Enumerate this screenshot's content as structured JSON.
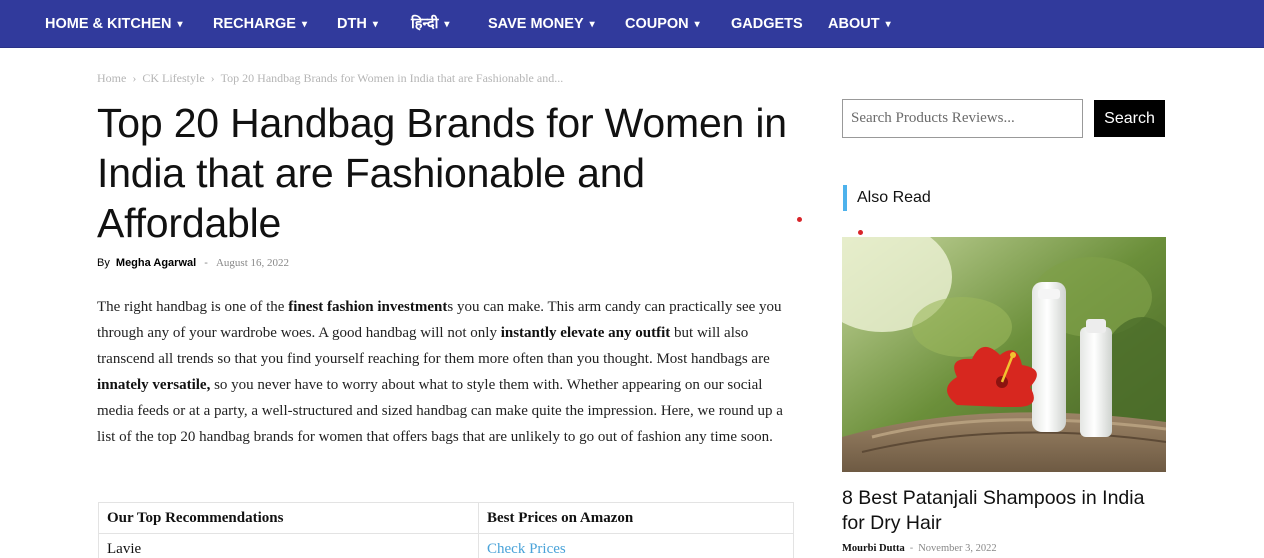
{
  "nav": {
    "items": [
      {
        "label": "HOME & KITCHEN",
        "has_dropdown": true
      },
      {
        "label": "RECHARGE",
        "has_dropdown": true
      },
      {
        "label": "DTH",
        "has_dropdown": true
      },
      {
        "label": "हिन्दी",
        "has_dropdown": true
      },
      {
        "label": "SAVE MONEY",
        "has_dropdown": true
      },
      {
        "label": "COUPON",
        "has_dropdown": true
      },
      {
        "label": "GADGETS",
        "has_dropdown": false
      },
      {
        "label": "ABOUT",
        "has_dropdown": true
      }
    ],
    "chevron": "▾",
    "background_color": "#313a9c"
  },
  "breadcrumb": {
    "home": "Home",
    "category": "CK Lifestyle",
    "current": "Top 20 Handbag Brands for Women in India that are Fashionable and...",
    "separator": "›"
  },
  "article": {
    "title": "Top 20 Handbag Brands for Women in India that are Fashionable and Affordable",
    "by_label": "By",
    "author": "Megha Agarwal",
    "meta_separator": "-",
    "date": "August 16, 2022",
    "intro": {
      "p1": "The right handbag is one of the ",
      "b1": "finest fashion investment",
      "p2": "s you can make. This arm candy can practically see you through any of your wardrobe woes. A good handbag will not only ",
      "b2": "instantly elevate any outfit",
      "p3": " but will also transcend all trends so that you find yourself reaching for them more often than you thought. Most handbags are ",
      "b3": "innately versatile,",
      "p4": " so you never have to worry about what to style them with. Whether appearing on our social media feeds or at a party, a well-structured and sized handbag can make quite the impression. Here, we round up a list of the top 20 handbag brands for women that offers bags that are unlikely to go out of fashion any time soon."
    }
  },
  "recommendations": {
    "headers": [
      "Our Top Recommendations",
      "Best Prices on Amazon"
    ],
    "rows": [
      {
        "name": "Lavie",
        "link_label": "Check Prices"
      }
    ],
    "link_color": "#4aa3d9"
  },
  "sidebar": {
    "search": {
      "placeholder": "Search Products Reviews...",
      "button_label": "Search"
    },
    "also_read": {
      "label": "Also Read",
      "accent_color": "#4db2ec",
      "post": {
        "title": "8 Best Patanjali Shampoos in India for Dry Hair",
        "author": "Mourbi Dutta",
        "separator": "-",
        "date": "November 3, 2022",
        "image": "shampoo-bottles-with-red-hibiscus-flower"
      }
    }
  },
  "accent_red": "#d8242a"
}
